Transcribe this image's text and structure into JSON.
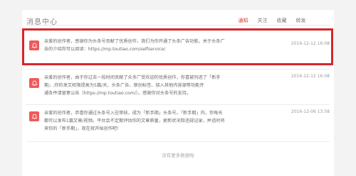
{
  "header": {
    "title": "消息中心",
    "tabs": [
      "通知",
      "关注",
      "收藏",
      "转发"
    ]
  },
  "messages": [
    {
      "line1": "亲爱的创作者，感谢你为头条号贡献了优质创作，我们为你开通了头条广告功能，关于头条广",
      "line2": "告的介绍你可以阅读：",
      "link": "https://mp.toutiao.com/selfservice/",
      "time": "2016-12-12 16:08",
      "icon": "bell-icon"
    },
    {
      "line1": "亲爱的创作者，由于你过去一段时间贡献了众多广受欢迎的优质创作，你喜被列进了「新手",
      "line2": "期」,你的发文权限提高为5篇/天，头条广告、原创标签、接入其他内容源等功能开",
      "line3": "通条件请留意公告（https://mp.toutiao.com/）。感谢你对头条号的支持。",
      "time": "2016-12-12 16:08",
      "icon": "bell-icon"
    },
    {
      "line1": "亲爱的创作者，恭喜你通过头条号入驻审核，成为「新手期」头条号。「新手期」内，你每天",
      "line2": "都可以发布1篇文章/视频。平台会不定期评估你的文章质量，更新状况和违规记录，并适时将",
      "line3": "来你的「新手期」，现在就开始创作吧！",
      "time": "2016-12-06 13:58",
      "icon": "bell-icon"
    }
  ],
  "footer": {
    "note": "没有更多数据啦"
  }
}
